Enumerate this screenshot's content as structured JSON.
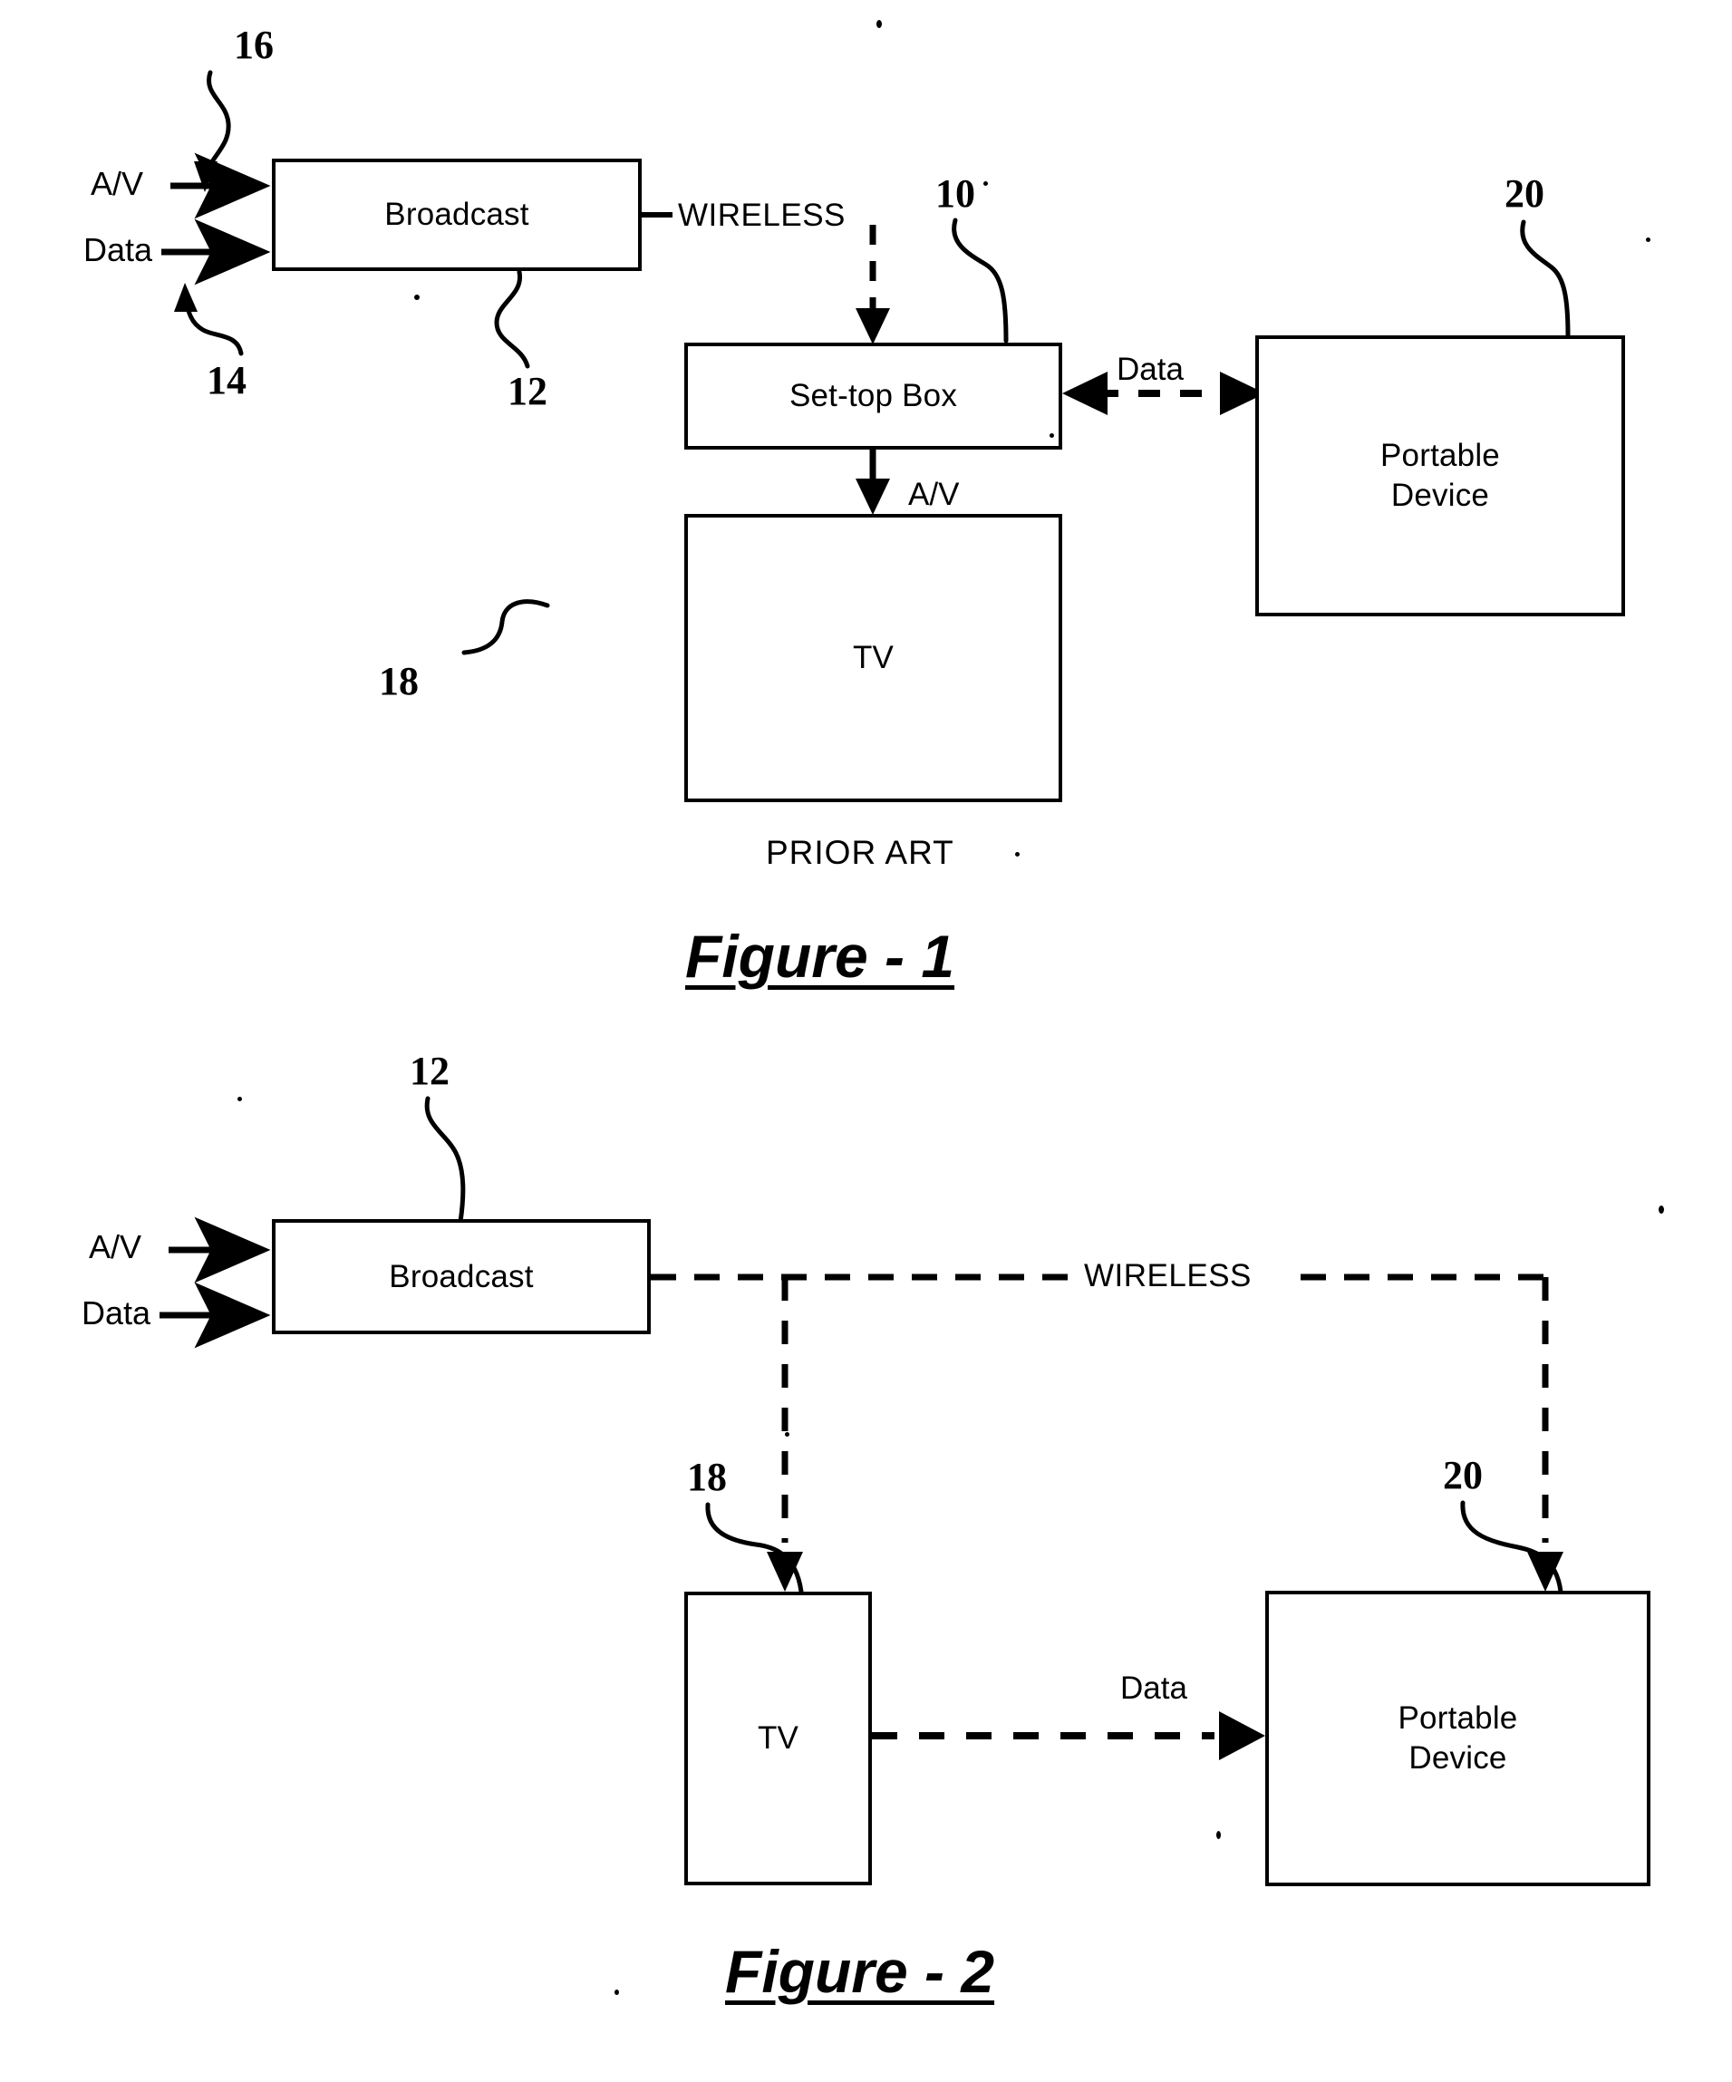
{
  "document": {
    "type": "patent-drawing-sheet",
    "background_color": "#ffffff",
    "line_color": "#000000"
  },
  "figure1": {
    "caption": "Figure - 1",
    "prior_art_label": "PRIOR ART",
    "boxes": [
      {
        "id": "broadcast",
        "label": "Broadcast",
        "ref": "12"
      },
      {
        "id": "settopbox",
        "label": "Set-top Box",
        "ref": "10"
      },
      {
        "id": "tv",
        "label": "TV",
        "ref": "18"
      },
      {
        "id": "portable",
        "label": "Portable\nDevice",
        "ref": "20"
      }
    ],
    "box_labels": {
      "broadcast": "Broadcast",
      "settopbox": "Set-top Box",
      "tv": "TV",
      "portable_line1": "Portable",
      "portable_line2": "Device"
    },
    "input_labels": {
      "av": "A/V",
      "data": "Data"
    },
    "reference_numerals": {
      "av_input": "16",
      "data_input": "14",
      "broadcast": "12",
      "settopbox": "10",
      "tv": "18",
      "portable": "20"
    },
    "connection_labels": {
      "wireless": "WIRELESS",
      "av_out": "A/V",
      "data_link": "Data"
    }
  },
  "figure2": {
    "caption": "Figure - 2",
    "boxes": [
      {
        "id": "broadcast",
        "label": "Broadcast",
        "ref": "12"
      },
      {
        "id": "tv",
        "label": "TV",
        "ref": "18"
      },
      {
        "id": "portable",
        "label": "Portable\nDevice",
        "ref": "20"
      }
    ],
    "box_labels": {
      "broadcast": "Broadcast",
      "tv": "TV",
      "portable_line1": "Portable",
      "portable_line2": "Device"
    },
    "input_labels": {
      "av": "A/V",
      "data": "Data"
    },
    "reference_numerals": {
      "broadcast": "12",
      "tv": "18",
      "portable": "20"
    },
    "connection_labels": {
      "wireless": "WIRELESS",
      "data_link": "Data"
    }
  }
}
